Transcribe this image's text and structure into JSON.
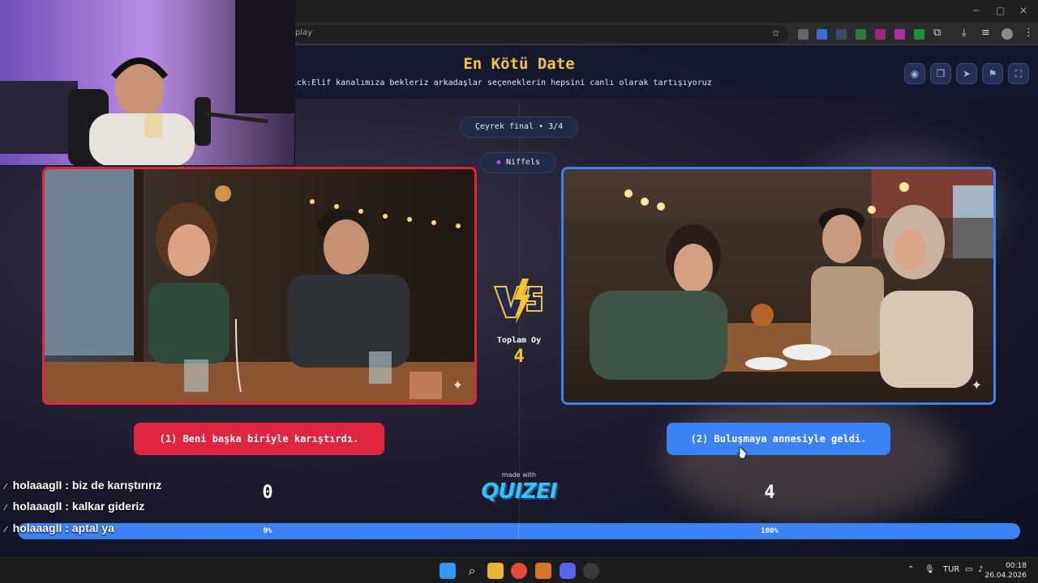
{
  "browser": {
    "url_fragment": "play",
    "window_controls": {
      "minimize": "─",
      "maximize": "▢",
      "close": "✕"
    }
  },
  "quiz": {
    "title": "En Kötü Date",
    "subtitle": "ick:Elif kanalımıza bekleriz arkadaşlar seçeneklerin hepsini canlı olarak tartışıyoruz",
    "round_label": "Çeyrek final • 3/4",
    "channel_name": "Niffels",
    "total_votes_label": "Toplam Oy",
    "total_votes": "4",
    "options": [
      {
        "label": "(1) Beni başka biriyle karıştırdı.",
        "votes": "0",
        "percent_label": "0%",
        "percent": 0
      },
      {
        "label": "(2) Buluşmaya annesiyle geldi.",
        "votes": "4",
        "percent_label": "100%",
        "percent": 100
      }
    ],
    "made_with": "made with",
    "logo_text": "QUIZEI"
  },
  "chat": [
    {
      "user": "holaaaglI",
      "message": "biz de karıştırırız"
    },
    {
      "user": "holaaaglI",
      "message": "kalkar gideriz"
    },
    {
      "user": "holaaaglI",
      "message": "aptal ya"
    }
  ],
  "taskbar": {
    "language": "TUR",
    "time": "00:18",
    "date": "26.04.2026"
  },
  "colors": {
    "accent_yellow": "#f5c531",
    "option_red": "#e0253e",
    "option_blue": "#3b82f6"
  }
}
